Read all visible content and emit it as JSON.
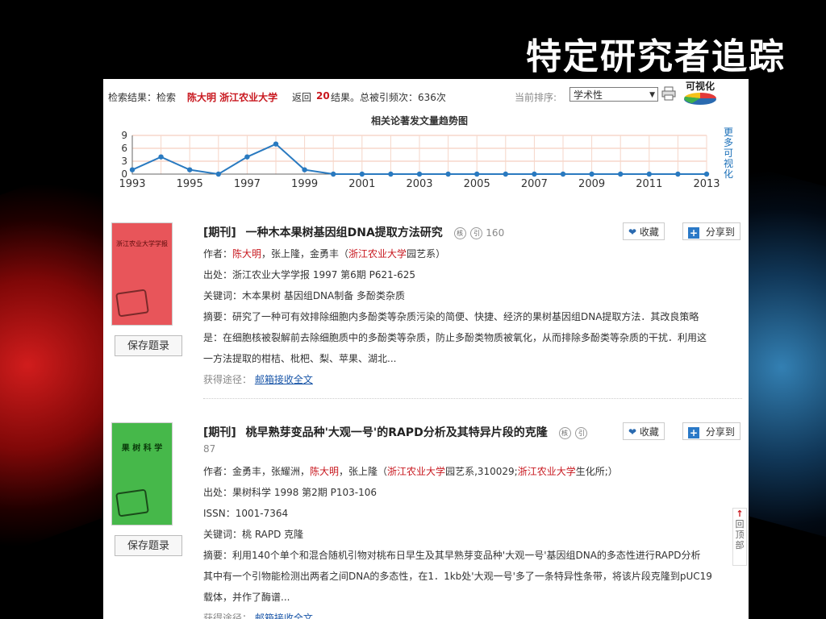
{
  "slide": {
    "title": "特定研究者追踪"
  },
  "search": {
    "label": "检索结果：检索",
    "query": "陈大明 浙江农业大学",
    "returned_prefix": "返回",
    "count": "20",
    "count_suffix": "结果。总被引频次：636次",
    "sort_label": "当前排序:",
    "sort_value": "学术性",
    "viz_label": "可视化"
  },
  "chart_data": {
    "type": "line",
    "title": "相关论著发文量趋势图",
    "x": [
      1993,
      1994,
      1995,
      1996,
      1997,
      1998,
      1999,
      2000,
      2001,
      2002,
      2003,
      2004,
      2005,
      2006,
      2007,
      2008,
      2009,
      2010,
      2011,
      2012,
      2013
    ],
    "values": [
      1,
      4,
      1,
      0,
      4,
      7,
      1,
      0,
      0,
      0,
      0,
      0,
      0,
      0,
      0,
      0,
      0,
      0,
      0,
      0,
      0
    ],
    "xticks": [
      "1993",
      "1995",
      "1997",
      "1999",
      "2001",
      "2003",
      "2005",
      "2007",
      "2009",
      "2011",
      "2013"
    ],
    "yticks": [
      "0",
      "3",
      "6",
      "9"
    ],
    "ylim": [
      0,
      9
    ],
    "xlim": [
      1993,
      2013
    ],
    "grid": true,
    "line_color": "#2a7ac0",
    "more_label": "更多可视化"
  },
  "records": [
    {
      "type": "[期刊]",
      "title": "一种木本果树基因组DNA提取方法研究",
      "badge_core": "核",
      "badge_cite": "引",
      "cited": "160",
      "authors_prefix": "作者：",
      "author_highlight": "陈大明",
      "authors_rest": "，张上隆，金勇丰（",
      "org_highlight": "浙江农业大学",
      "org_rest": "园艺系）",
      "source": "出处：浙江农业大学学报 1997 第6期 P621-625",
      "keywords": "关键词：木本果树  基因组DNA制备  多酚类杂质",
      "abstract_1": "摘要：研究了一种可有效排除细胞内多酚类等杂质污染的简便、快捷、经济的果树基因组DNA提取方法．其改良策略",
      "abstract_2": "是：在细胞核被裂解前去除细胞质中的多酚类等杂质，防止多酚类物质被氧化，从而排除多酚类等杂质的干扰．利用这",
      "abstract_3": "一方法提取的柑桔、枇杷、梨、苹果、湖北...",
      "access_label": "获得途径：",
      "access_link": "邮箱接收全文",
      "save_label": "保存题录",
      "collect_label": "收藏",
      "share_label": "分享到",
      "cover_color": "#e8555a",
      "cover_title": "浙江农业大学学报"
    },
    {
      "type": "[期刊]",
      "title": "桃早熟芽变品种'大观一号'的RAPD分析及其特异片段的克隆",
      "badge_core": "核",
      "badge_cite": "引",
      "cited": "87",
      "authors_prefix": "作者：金勇丰，张耀洲，",
      "author_highlight": "陈大明",
      "authors_rest": "，张上隆（",
      "org_highlight": "浙江农业大学",
      "org_mid": "园艺系,310029;",
      "org_highlight_2": "浙江农业大学",
      "org_rest": "生化所;）",
      "source": "出处：果树科学 1998 第2期 P103-106",
      "issn": "ISSN：1001-7364",
      "keywords": "关键词：桃  RAPD  克隆",
      "abstract_1": "摘要：利用140个单个和混合随机引物对桃布日早生及其早熟芽变品种'大观一号'基因组DNA的多态性进行RAPD分析",
      "abstract_2": "其中有一个引物能检测出两者之间DNA的多态性，在1．1kb处'大观一号'多了一条特异性条带，将该片段克隆到pUC19",
      "abstract_3": "载体，并作了酶谱...",
      "access_label": "获得途径：",
      "access_link": "邮箱接收全文",
      "save_label": "保存题录",
      "collect_label": "收藏",
      "share_label": "分享到",
      "cover_color": "#46b84a",
      "cover_title": "果 树 科 学"
    }
  ],
  "back_top": "回顶部"
}
